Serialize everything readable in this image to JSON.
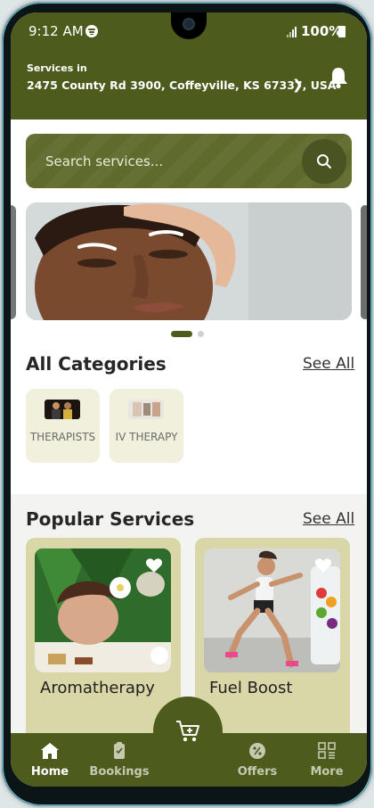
{
  "status_bar": {
    "time": "9:12 AM",
    "battery": "100%"
  },
  "header": {
    "services_in_label": "Services in",
    "address": "2475 County Rd 3900, Coffeyville, KS 67337, USA"
  },
  "search": {
    "placeholder": "Search services..."
  },
  "banner": {
    "slides": 2,
    "active_slide": 1
  },
  "categories": {
    "title": "All Categories",
    "see_all": "See All",
    "items": [
      {
        "label": "THERAPISTS"
      },
      {
        "label": "IV THERAPY"
      }
    ]
  },
  "popular": {
    "title": "Popular Services",
    "see_all": "See All",
    "items": [
      {
        "title": "Aromatherapy"
      },
      {
        "title": "Fuel Boost"
      }
    ]
  },
  "bottom_nav": {
    "items": [
      {
        "label": "Home",
        "icon": "home-icon",
        "active": true
      },
      {
        "label": "Bookings",
        "icon": "clipboard-icon",
        "active": false
      },
      {
        "label": "Offers",
        "icon": "percent-badge-icon",
        "active": false
      },
      {
        "label": "More",
        "icon": "grid-icon",
        "active": false
      }
    ],
    "cart_icon": "cart-plus-icon"
  },
  "colors": {
    "primary": "#4d5b1d",
    "card_light": "#f0f0dc",
    "card_service": "#d9d7a8"
  }
}
